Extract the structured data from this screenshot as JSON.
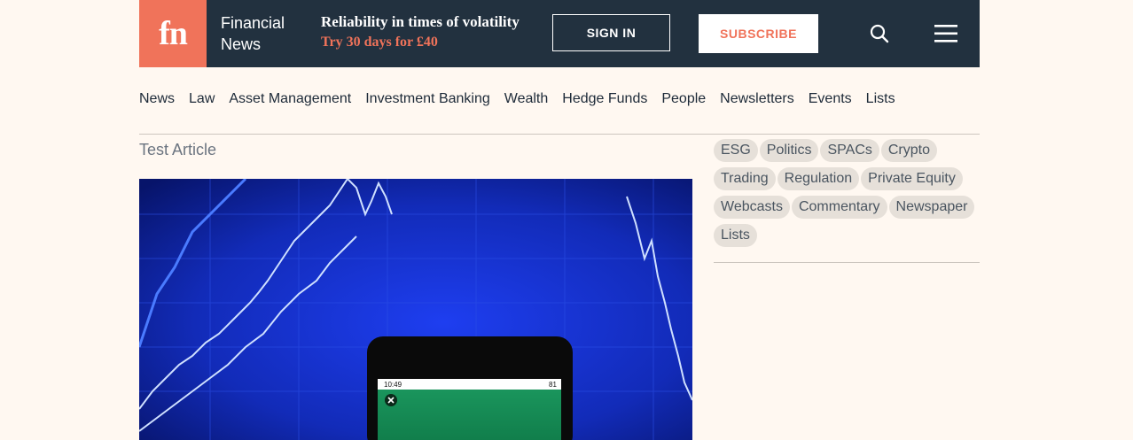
{
  "header": {
    "logo_text": "fn",
    "brand_line1": "Financial",
    "brand_line2": "News",
    "promo_title": "Reliability in times of volatility",
    "promo_sub": "Try 30 days for £40",
    "sign_in": "SIGN IN",
    "subscribe": "SUBSCRIBE",
    "colors": {
      "bar": "#22313f",
      "accent": "#f0735a"
    }
  },
  "nav": {
    "items": [
      "News",
      "Law",
      "Asset Management",
      "Investment Banking",
      "Wealth",
      "Hedge Funds",
      "People",
      "Newsletters",
      "Events",
      "Lists"
    ]
  },
  "article": {
    "label": "Test Article",
    "phone_time": "10:49",
    "phone_battery": "81"
  },
  "sidebar": {
    "tags": [
      "ESG",
      "Politics",
      "SPACs",
      "Crypto",
      "Trading",
      "Regulation",
      "Private Equity",
      "Webcasts",
      "Commentary",
      "Newspaper",
      "Lists"
    ]
  },
  "icons": [
    "search-icon",
    "menu-icon",
    "close-icon"
  ]
}
